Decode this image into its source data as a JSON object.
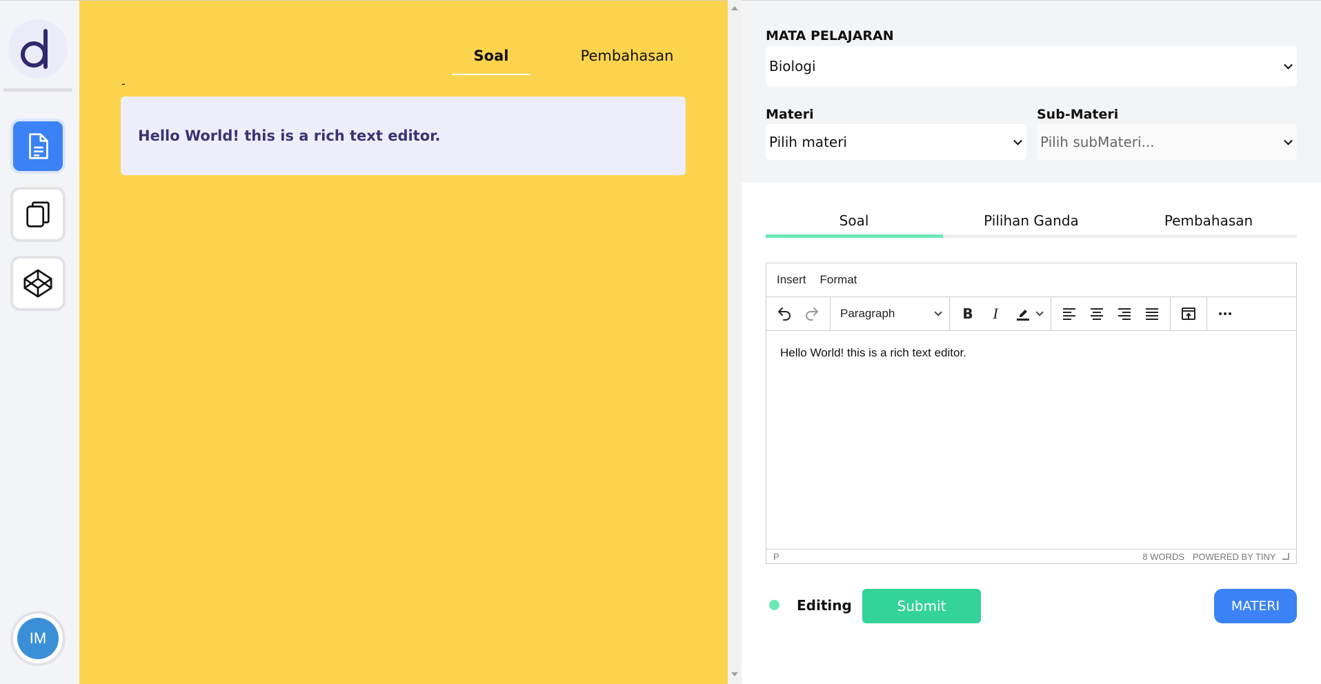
{
  "sidebar": {
    "logo_letter": "d",
    "nav": [
      {
        "icon": "document-icon",
        "active": true
      },
      {
        "icon": "copy-icon",
        "active": false
      },
      {
        "icon": "codepen-icon",
        "active": false
      }
    ],
    "avatar_initials": "IM"
  },
  "preview": {
    "tabs": [
      "Soal",
      "Pembahasan"
    ],
    "active_tab": "Soal",
    "question_number": "-",
    "content": "Hello World! this is a rich text editor."
  },
  "form": {
    "mapel_label": "MATA PELAJARAN",
    "mapel_value": "Biologi",
    "materi_label": "Materi",
    "materi_value": "Pilih materi",
    "submateri_label": "Sub-Materi",
    "submateri_placeholder": "Pilih subMateri..."
  },
  "editor_tabs": [
    "Soal",
    "Pilihan Ganda",
    "Pembahasan"
  ],
  "editor_active_tab": "Soal",
  "rte": {
    "menu": [
      "Insert",
      "Format"
    ],
    "block_format": "Paragraph",
    "content": "Hello World! this is a rich text editor.",
    "status_path": "P",
    "word_count": "8 WORDS",
    "powered_by": "POWERED BY TINY"
  },
  "footer": {
    "status_label": "Editing",
    "submit_label": "Submit",
    "materi_label": "MATERI"
  },
  "colors": {
    "preview_bg": "#fcd34d",
    "accent_blue": "#3b82f6",
    "accent_green": "#34d399",
    "tab_indicator": "#6ee7b7"
  }
}
